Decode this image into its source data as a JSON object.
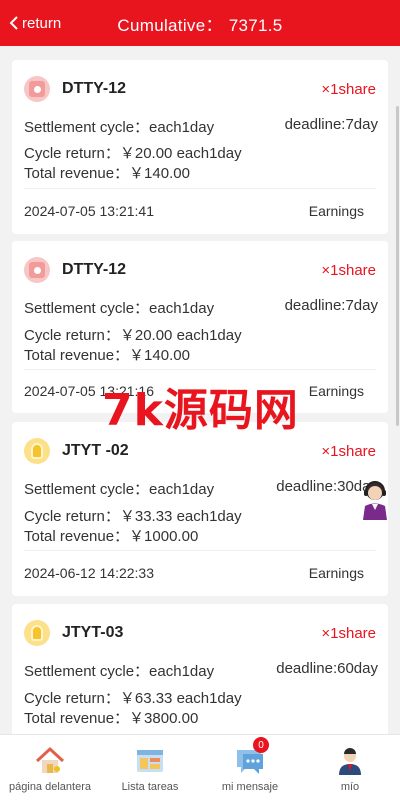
{
  "header": {
    "back_label": "return",
    "title_label": "Cumulative：",
    "title_value": "7371.5"
  },
  "colors": {
    "brand": "#e8141e"
  },
  "orders": [
    {
      "icon": "gift-box-icon",
      "name": "DTTY-12",
      "share": "×1share",
      "settlement": "Settlement cycle：each1day",
      "deadline": "deadline:7day",
      "cycle_return": "Cycle return：￥20.00 each1day",
      "total_revenue": "Total revenue：￥140.00",
      "date": "2024-07-05 13:21:41",
      "status": "Earnings"
    },
    {
      "icon": "gift-box-icon",
      "name": "DTTY-12",
      "share": "×1share",
      "settlement": "Settlement cycle：each1day",
      "deadline": "deadline:7day",
      "cycle_return": "Cycle return：￥20.00 each1day",
      "total_revenue": "Total revenue：￥140.00",
      "date": "2024-07-05 13:21:16",
      "status": "Earnings"
    },
    {
      "icon": "lightbulb-icon",
      "name": "JTYT -02",
      "share": "×1share",
      "settlement": "Settlement cycle：each1day",
      "deadline": "deadline:30day",
      "cycle_return": "Cycle return：￥33.33 each1day",
      "total_revenue": "Total revenue：￥1000.00",
      "date": "2024-06-12 14:22:33",
      "status": "Earnings"
    },
    {
      "icon": "lightbulb-icon",
      "name": "JTYT-03",
      "share": "×1share",
      "settlement": "Settlement cycle：each1day",
      "deadline": "deadline:60day",
      "cycle_return": "Cycle return：￥63.33 each1day",
      "total_revenue": "Total revenue：￥3800.00",
      "date": "",
      "status": ""
    }
  ],
  "watermark": "7k源码网",
  "tabs": [
    {
      "label": "página delantera",
      "icon": "home-icon"
    },
    {
      "label": "Lista tareas",
      "icon": "task-list-icon"
    },
    {
      "label": "mi mensaje",
      "icon": "message-icon",
      "badge": "0"
    },
    {
      "label": "mío",
      "icon": "user-icon"
    }
  ]
}
